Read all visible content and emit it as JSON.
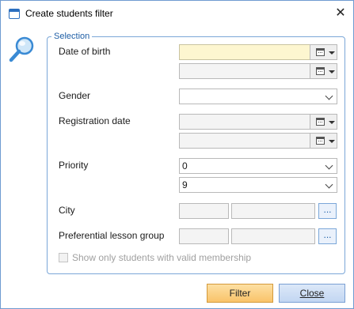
{
  "window": {
    "title": "Create students filter"
  },
  "group": {
    "legend": "Selection"
  },
  "labels": {
    "date_of_birth": "Date of birth",
    "gender": "Gender",
    "registration_date": "Registration date",
    "priority": "Priority",
    "city": "City",
    "preferential_lesson_group": "Preferential lesson group"
  },
  "fields": {
    "priority_from": "0",
    "priority_to": "9",
    "gender": "",
    "ellipsis": "..."
  },
  "checkbox": {
    "label": "Show only students with valid membership",
    "checked": false,
    "enabled": false
  },
  "buttons": {
    "filter": "Filter",
    "close": "Close"
  },
  "icons": [
    "app-window-icon",
    "close-icon",
    "search-icon",
    "calendar-icon",
    "chevron-down-icon"
  ],
  "colors": {
    "accent": "#7ba7d8",
    "active_field": "#fdf6d0",
    "filter_button": "#f9c36a",
    "close_button": "#c2d6f2"
  }
}
